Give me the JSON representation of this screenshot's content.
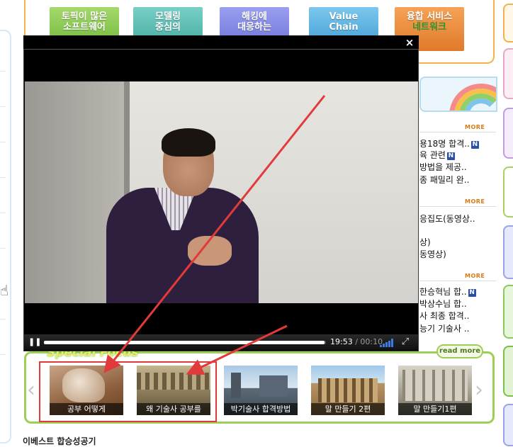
{
  "banner_tiles": [
    {
      "line1": "토픽이 많은",
      "line2": "소프트웨어"
    },
    {
      "line1": "모델링",
      "line2": "중심의"
    },
    {
      "line1": "해킹에",
      "line2": "대응하는"
    },
    {
      "line1": "Value",
      "line2": "Chain"
    },
    {
      "line1": "융합 서비스",
      "line2": "네트워크"
    }
  ],
  "sidebar_news": {
    "more_label": "MORE",
    "section1": [
      "용18명 합격..",
      "육 관련",
      "방법을 제공..",
      "종 패밀리 완.."
    ],
    "section1_new_rows": [
      0,
      1
    ],
    "section2": [
      "응집도(동영상..",
      "상)",
      "동영상)"
    ],
    "section3": [
      "한승혁님 합..",
      "박상수님 합..",
      "사 최종 합격..",
      "능기 기술사 .."
    ],
    "section3_new_rows": [
      0
    ],
    "new_badge": "N"
  },
  "special_focus": {
    "title": "Special Focus",
    "read_more": "read more",
    "prev": "‹",
    "next": "›",
    "items": [
      {
        "caption": "공부 어떻게"
      },
      {
        "caption": "왜 기술사 공부를"
      },
      {
        "caption": "박기술사 합격방법"
      },
      {
        "caption": "말 만들기 2편"
      },
      {
        "caption": "말 만들기1편"
      }
    ]
  },
  "bottom_heading": "이베스트 합승성공기",
  "video_player": {
    "close": "×",
    "pause_icon": "❚❚",
    "current_time": "19:53",
    "separator": " / ",
    "duration": "00:10",
    "progress": 0.995,
    "fullscreen_icon": "⤢"
  },
  "annotation_color": "#e23a3a"
}
